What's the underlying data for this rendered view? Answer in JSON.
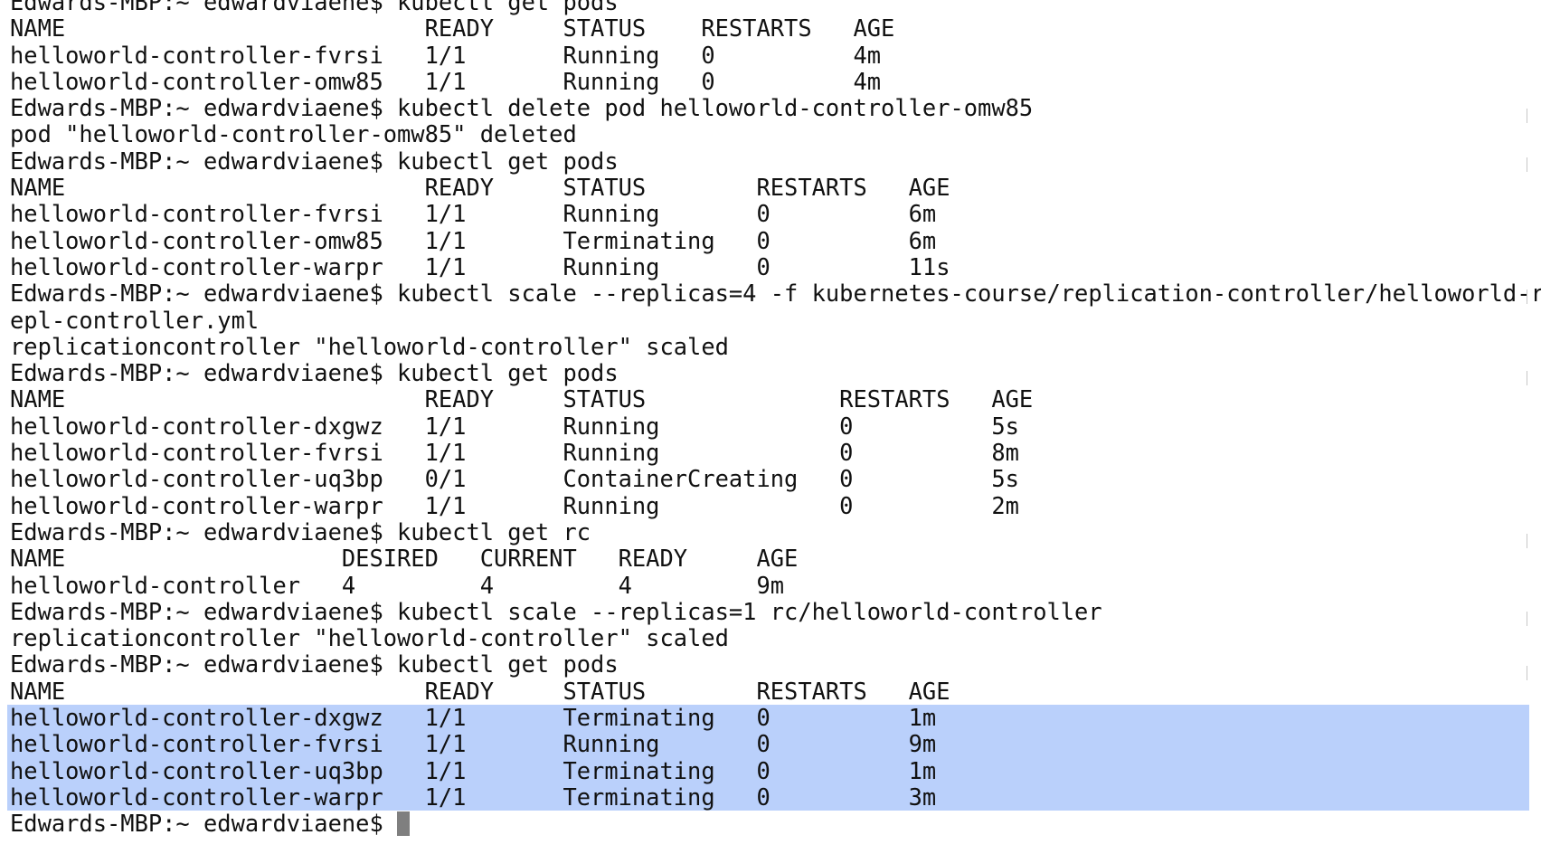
{
  "terminal": {
    "prompt": "Edwards-MBP:~ edwardviaene$ ",
    "lines": [
      "Edwards-MBP:~ edwardviaene$ kubectl get pods",
      "NAME                          READY     STATUS    RESTARTS   AGE",
      "helloworld-controller-fvrsi   1/1       Running   0          4m",
      "helloworld-controller-omw85   1/1       Running   0          4m",
      "Edwards-MBP:~ edwardviaene$ kubectl delete pod helloworld-controller-omw85",
      "pod \"helloworld-controller-omw85\" deleted",
      "Edwards-MBP:~ edwardviaene$ kubectl get pods",
      "NAME                          READY     STATUS        RESTARTS   AGE",
      "helloworld-controller-fvrsi   1/1       Running       0          6m",
      "helloworld-controller-omw85   1/1       Terminating   0          6m",
      "helloworld-controller-warpr   1/1       Running       0          11s",
      "Edwards-MBP:~ edwardviaene$ kubectl scale --replicas=4 -f kubernetes-course/replication-controller/helloworld-r",
      "epl-controller.yml",
      "replicationcontroller \"helloworld-controller\" scaled",
      "Edwards-MBP:~ edwardviaene$ kubectl get pods",
      "NAME                          READY     STATUS              RESTARTS   AGE",
      "helloworld-controller-dxgwz   1/1       Running             0          5s",
      "helloworld-controller-fvrsi   1/1       Running             0          8m",
      "helloworld-controller-uq3bp   0/1       ContainerCreating   0          5s",
      "helloworld-controller-warpr   1/1       Running             0          2m",
      "Edwards-MBP:~ edwardviaene$ kubectl get rc",
      "NAME                    DESIRED   CURRENT   READY     AGE",
      "helloworld-controller   4         4         4         9m",
      "Edwards-MBP:~ edwardviaene$ kubectl scale --replicas=1 rc/helloworld-controller",
      "replicationcontroller \"helloworld-controller\" scaled",
      "Edwards-MBP:~ edwardviaene$ kubectl get pods",
      "NAME                          READY     STATUS        RESTARTS   AGE",
      "helloworld-controller-dxgwz   1/1       Terminating   0          1m",
      "helloworld-controller-fvrsi   1/1       Running       0          9m",
      "helloworld-controller-uq3bp   1/1       Terminating   0          1m",
      "helloworld-controller-warpr   1/1       Terminating   0          3m"
    ]
  },
  "colors": {
    "background": "#ffffff",
    "text": "#111111",
    "selection": "#bad0fb",
    "cursor": "#7f7f7f"
  }
}
